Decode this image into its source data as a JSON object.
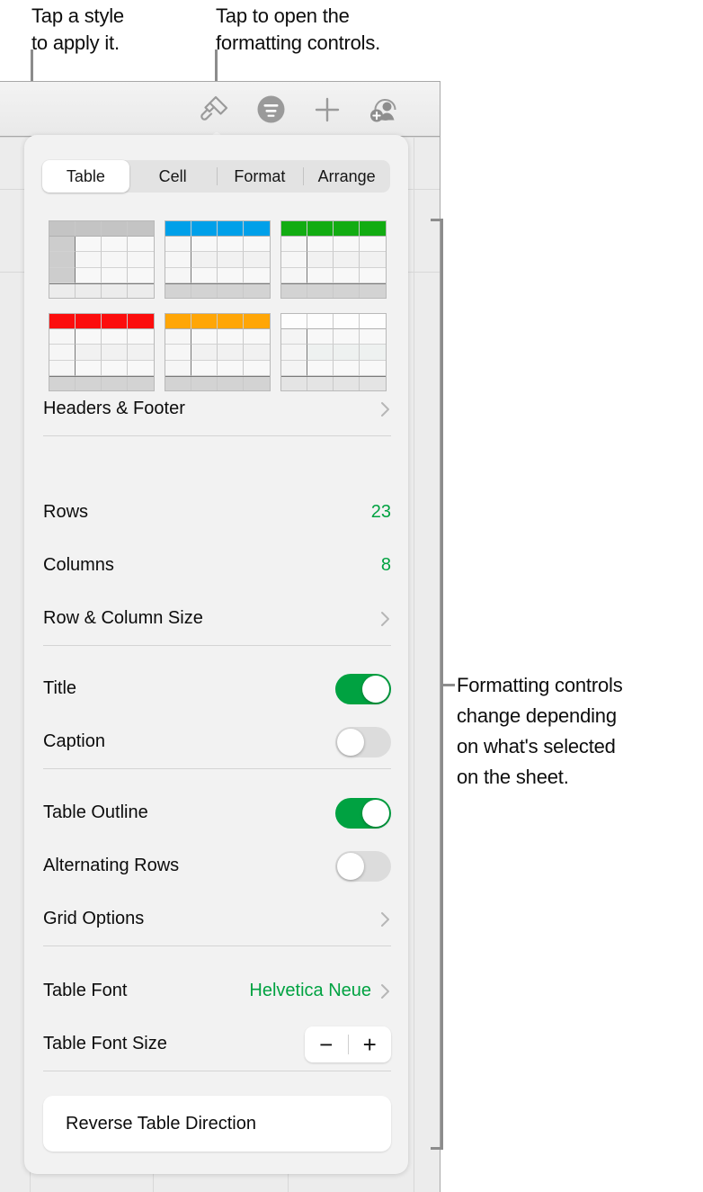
{
  "annotations": {
    "top_left": "Tap a style\nto apply it.",
    "top_right": "Tap to open the\nformatting controls.",
    "right": "Formatting controls\nchange depending\non what's selected\non the sheet."
  },
  "toolbar": {
    "icons": [
      {
        "name": "format-paintbrush-icon",
        "label": "Format"
      },
      {
        "name": "insert-organize-icon",
        "label": "Insert"
      },
      {
        "name": "plus-icon",
        "label": "Add"
      },
      {
        "name": "collaborate-add-person-icon",
        "label": "Collaborate"
      }
    ]
  },
  "popover": {
    "tabs": [
      {
        "label": "Table",
        "selected": true
      },
      {
        "label": "Cell",
        "selected": false
      },
      {
        "label": "Format",
        "selected": false
      },
      {
        "label": "Arrange",
        "selected": false
      }
    ],
    "styles": [
      {
        "name": "table-style-gray",
        "header_color": "#c4c4c4",
        "selected": true,
        "footer_color": "#ececec",
        "first_col_color": "#cdcdcd",
        "body_color": "#f6f6f6"
      },
      {
        "name": "table-style-blue",
        "header_color": "#00a0e9",
        "selected": false,
        "footer_color": "#d3d3d3",
        "first_col_color": "#f6f6f6",
        "body_color": "#f1f1f1"
      },
      {
        "name": "table-style-green",
        "header_color": "#12ac12",
        "selected": false,
        "footer_color": "#d3d3d3",
        "first_col_color": "#f6f6f6",
        "body_color": "#f1f1f1"
      },
      {
        "name": "table-style-red",
        "header_color": "#fc0d0d",
        "selected": false,
        "footer_color": "#d3d3d3",
        "first_col_color": "#f6f6f6",
        "body_color": "#f1f1f1"
      },
      {
        "name": "table-style-orange",
        "header_color": "#ffa607",
        "selected": false,
        "footer_color": "#d3d3d3",
        "first_col_color": "#f6f6f6",
        "body_color": "#f1f1f1"
      },
      {
        "name": "table-style-plain",
        "header_color": "#fdfdfd",
        "selected": false,
        "footer_color": "#e4e4e4",
        "first_col_color": "#f4f4f4",
        "body_color": "#eef1f0"
      }
    ],
    "rows": {
      "headers_footer": {
        "label": "Headers & Footer",
        "accessory": "chevron"
      },
      "rows_count": {
        "label": "Rows",
        "value": "23"
      },
      "columns_count": {
        "label": "Columns",
        "value": "8"
      },
      "row_column_size": {
        "label": "Row & Column Size",
        "accessory": "chevron"
      },
      "title": {
        "label": "Title",
        "state": "on"
      },
      "caption": {
        "label": "Caption",
        "state": "off"
      },
      "table_outline": {
        "label": "Table Outline",
        "state": "on"
      },
      "alternating_rows": {
        "label": "Alternating Rows",
        "state": "off"
      },
      "grid_options": {
        "label": "Grid Options",
        "accessory": "chevron"
      },
      "table_font": {
        "label": "Table Font",
        "value": "Helvetica Neue",
        "accessory": "chevron"
      },
      "table_font_size": {
        "label": "Table Font Size",
        "minus": "−",
        "plus": "+"
      },
      "reverse_table_direction": {
        "label": "Reverse Table Direction"
      }
    }
  },
  "colors": {
    "accent_green": "#00a241",
    "panel_bg": "#f2f2f2",
    "leader_line": "#8c8c8c"
  }
}
